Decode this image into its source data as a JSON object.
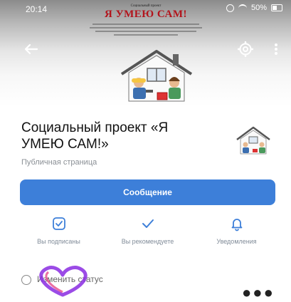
{
  "status_bar": {
    "time": "20:14",
    "battery": "50%"
  },
  "cover": {
    "top_text": "Социальный проект",
    "title": "Я УМЕЮ САМ!"
  },
  "icons": {
    "back": "arrow-left-icon",
    "settings": "gear-icon",
    "more": "more-vertical-icon",
    "subscribed": "check-square-icon",
    "recommend": "checkmark-icon",
    "notifications": "bell-icon",
    "status": "emoji-status-icon"
  },
  "profile": {
    "name": "Социальный проект «Я УМЕЮ САМ!»",
    "type": "Публичная страница"
  },
  "buttons": {
    "message": "Сообщение"
  },
  "actions": [
    {
      "label": "Вы подписаны"
    },
    {
      "label": "Вы рекомендуете"
    },
    {
      "label": "Уведомления"
    }
  ],
  "status": {
    "placeholder": "Изменить статус"
  },
  "colors": {
    "accent": "#3d7fd9",
    "secondary_text": "#818c99",
    "cover_title": "#b3141c"
  }
}
